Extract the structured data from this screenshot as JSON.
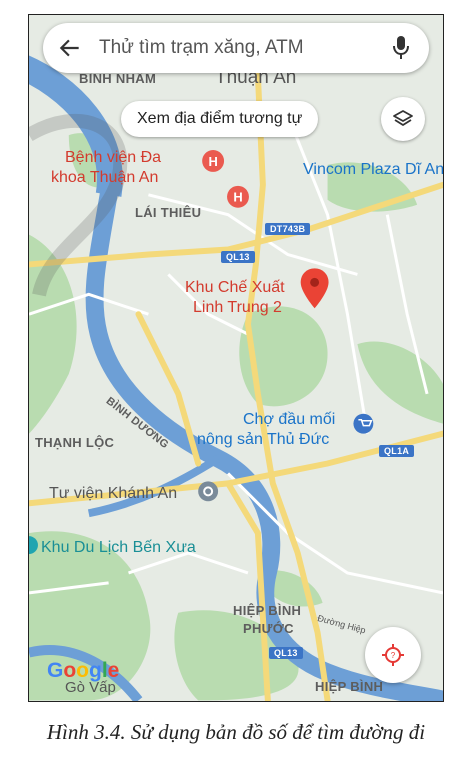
{
  "search": {
    "placeholder": "Thử tìm trạm xăng, ATM"
  },
  "chip": {
    "label": "Xem địa điểm tương tự"
  },
  "map": {
    "areas": {
      "binh_nham": "BÌNH NHÂM",
      "thuan_an": "Thuận An",
      "lai_thieu": "LÁI THIÊU",
      "binh_duong": "BÌNH DƯƠNG",
      "thanh_loc": "THẠNH LỘC",
      "hiep_binh_phuoc_1": "HIỆP BÌNH",
      "hiep_binh_phuoc_2": "PHƯỚC",
      "hiep_binh": "HIỆP BÌNH",
      "go_vap": "Gò Vấp",
      "duong_hiep": "Đường Hiệp"
    },
    "places": {
      "hospital_1": "Bệnh viện Đa",
      "hospital_2": "khoa Thuận An",
      "vincom": "Vincom Plaza Dĩ An",
      "pin_1": "Khu Chế Xuất",
      "pin_2": "Linh Trung 2",
      "market_1": "Chợ đầu mối",
      "market_2": "nông sản Thủ Đức",
      "library": "Tư viện Khánh An",
      "park": "Khu Du Lịch Bến Xưa"
    },
    "roads": {
      "dt743b": "DT743B",
      "ql13_top": "QL13",
      "ql1a": "QL1A",
      "ql13_bottom": "QL13"
    },
    "logo": "Google"
  },
  "caption": "Hình 3.4. Sử dụng bản đồ số để tìm đường đi",
  "colors": {
    "land": "#e6ebe4",
    "park": "#b9dcb0",
    "water": "#6d9fd6",
    "major_road": "#f4d97a",
    "minor_road": "#ffffff",
    "pin": "#ea4335",
    "accent_blue": "#1a73c9"
  }
}
